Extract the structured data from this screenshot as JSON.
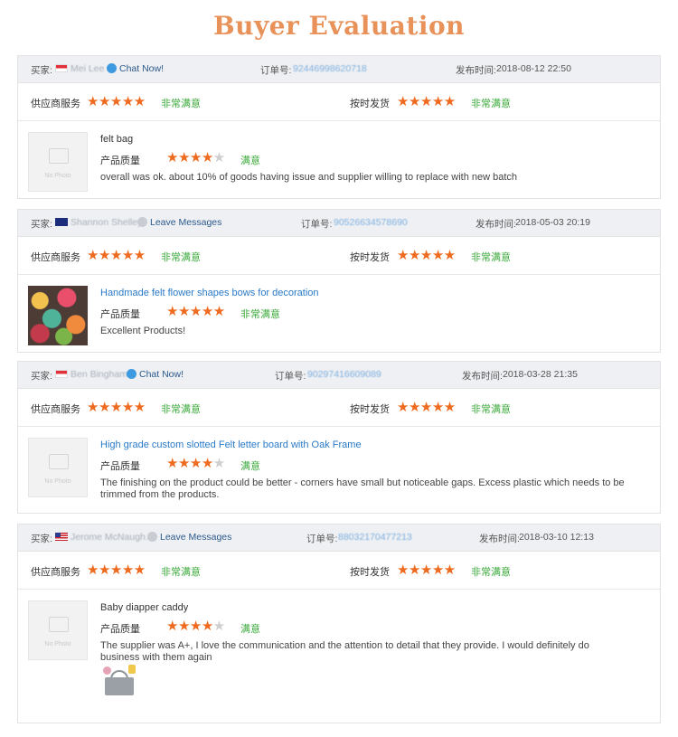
{
  "page_title": "Buyer Evaluation",
  "labels": {
    "buyer": "买家:",
    "order_no": "订单号:",
    "published": "发布时间:",
    "supplier_service": "供应商服务",
    "on_time_shipping": "按时发货",
    "product_quality": "产品质量",
    "no_photo": "No Photo"
  },
  "reviews": [
    {
      "buyer_name": "Mei Lee",
      "flag": "sg",
      "contact_label": "Chat Now!",
      "order_no": "92446998620718",
      "published": "2018-08-12 22:50",
      "supplier_service_verdict": "非常满意",
      "on_time_verdict": "非常满意",
      "product": "felt bag",
      "product_is_link": false,
      "quality_stars": 4,
      "quality_verdict": "满意",
      "comment": "overall was ok. about 10% of goods having issue and supplier willing to replace with new batch"
    },
    {
      "buyer_name": "Shannon Shelley",
      "flag": "au",
      "contact_label": "Leave Messages",
      "order_no": "90526634578690",
      "published": "2018-05-03 20:19",
      "supplier_service_verdict": "非常满意",
      "on_time_verdict": "非常满意",
      "product": "Handmade felt flower shapes bows for decoration",
      "product_is_link": true,
      "quality_stars": 5,
      "quality_verdict": "非常满意",
      "comment": "Excellent Products!"
    },
    {
      "buyer_name": "Ben Bingham",
      "flag": "sg",
      "contact_label": "Chat Now!",
      "order_no": "90297416609089",
      "published": "2018-03-28 21:35",
      "supplier_service_verdict": "非常满意",
      "on_time_verdict": "非常满意",
      "product": "High grade custom slotted Felt letter board with Oak Frame",
      "product_is_link": true,
      "quality_stars": 4,
      "quality_verdict": "满意",
      "comment": "The finishing on the product could be better - corners have small but noticeable gaps. Excess plastic which needs to be trimmed from the products."
    },
    {
      "buyer_name": "Jerome McNaugh...",
      "flag": "us",
      "contact_label": "Leave Messages",
      "order_no": "88032170477213",
      "published": "2018-03-10 12:13",
      "supplier_service_verdict": "非常满意",
      "on_time_verdict": "非常满意",
      "product": "Baby diapper caddy",
      "product_is_link": false,
      "quality_stars": 4,
      "quality_verdict": "满意",
      "comment": "The supplier was A+, I love the communication and the attention to detail that they provide. I would definitely do business with them again"
    }
  ],
  "colors": {
    "title": "#e8925a",
    "star": "#ef6a1e",
    "verdict": "#3aa83a",
    "link": "#2b7ac6"
  }
}
